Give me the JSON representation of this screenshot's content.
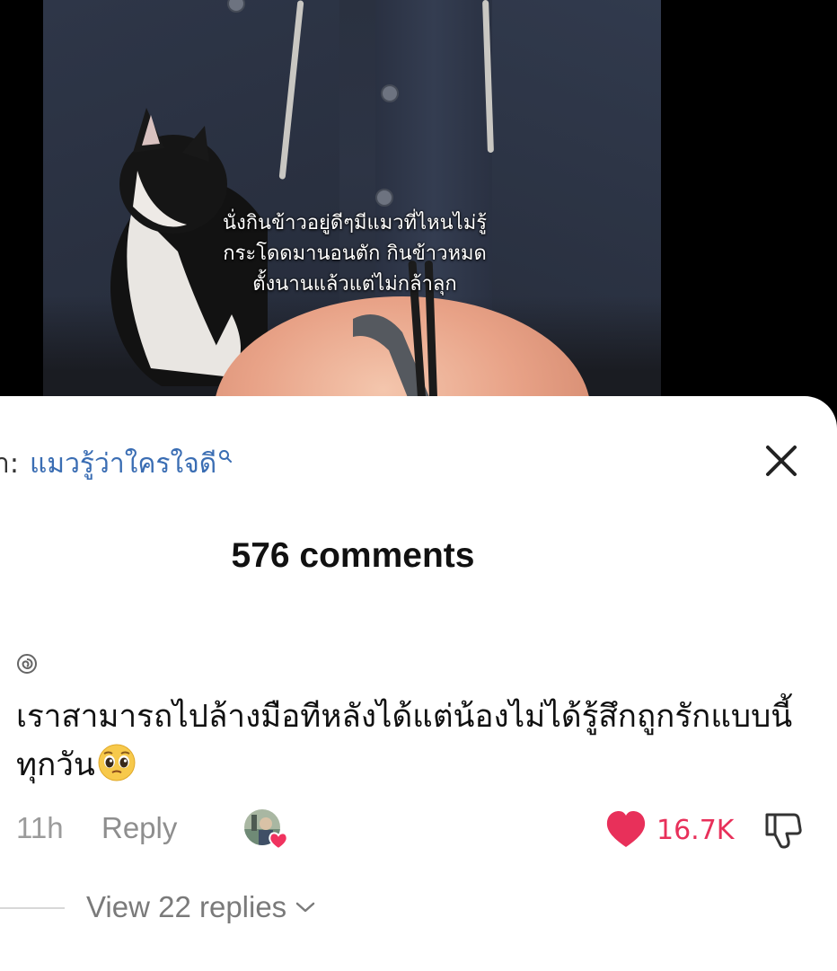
{
  "video": {
    "caption_lines": [
      "นั่งกินข้าวอยู่ดีๆมีแมวที่ไหนไม่รู้",
      "กระโดดมานอนตัก กินข้าวหมด",
      "ตั้งนานแล้วแต่ไม่กล้าลุก"
    ]
  },
  "search": {
    "prefix": "า:",
    "term": "แมวรู้ว่าใครใจดี"
  },
  "comments_header": {
    "count_label": "576 comments"
  },
  "comment": {
    "text": "เราสามารถไปล้างมือทีหลังได้แต่น้องไม่ได้รู้สึกถูกรักแบบนี้ทุกวัน",
    "emoji": "pleading-face-emoji",
    "time": "11h",
    "reply_label": "Reply",
    "like_count": "16.7K",
    "view_replies_label": "View 22 replies"
  },
  "colors": {
    "like": "#e8305a",
    "search_term": "#3a6db3",
    "muted": "#8e8e8e"
  }
}
